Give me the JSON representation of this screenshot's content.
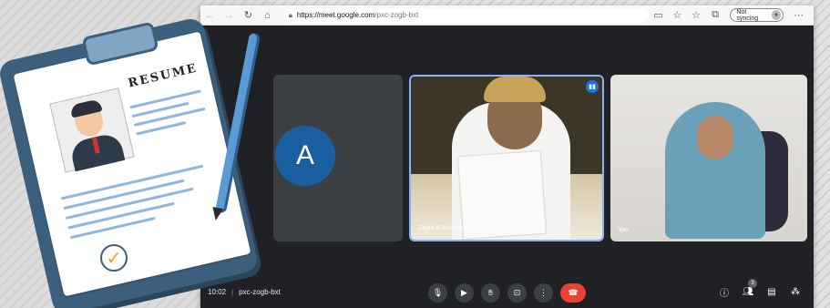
{
  "browser": {
    "url_host": "https://meet.google.com",
    "url_path": "/pxc-zogb-bxt",
    "sync_label": "Not syncing",
    "more_label": "···"
  },
  "meet": {
    "participant_a_initial": "A",
    "participant_b_name": "Zayid Al-Mabrouqi",
    "participant_c_name": "You",
    "time": "10:02",
    "meeting_code": "pxc-zogb-bxt",
    "participant_count": "3"
  },
  "illustration": {
    "resume_title": "RESUME"
  },
  "colors": {
    "avatar_blue": "#1a5fa0",
    "end_call_red": "#ea4335",
    "active_border": "#8ab4f8"
  }
}
